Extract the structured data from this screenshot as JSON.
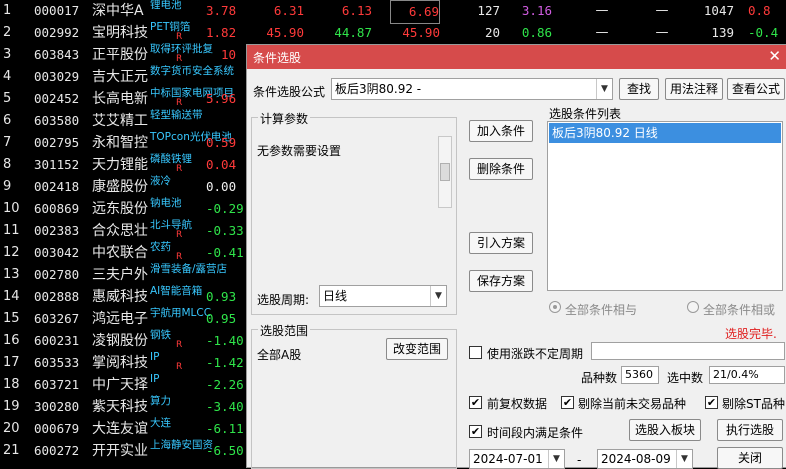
{
  "stocks": [
    {
      "idx": "1",
      "code": "000017",
      "name": "深中华A",
      "tag": "锂电池",
      "mark": "",
      "val": "3.78",
      "val_color": "red",
      "x1": "6.31",
      "x2": "6.13",
      "x3": "6.69",
      "x4": "127",
      "x5": "3.16",
      "x6": "—",
      "x7": "—",
      "x8": "1047",
      "x9": "0.8"
    },
    {
      "idx": "2",
      "code": "002992",
      "name": "宝明科技",
      "tag": "PET铜箔",
      "mark": "R",
      "val": "1.82",
      "val_color": "red",
      "x1": "45.90",
      "x2": "44.87",
      "x3": "45.90",
      "x4": "20",
      "x5": "0.86",
      "x6": "—",
      "x7": "—",
      "x8": "139",
      "x9": "-0.4"
    },
    {
      "idx": "3",
      "code": "603843",
      "name": "正平股份",
      "tag": "取得环评批复",
      "mark": "R",
      "val": "10",
      "val_color": "red"
    },
    {
      "idx": "4",
      "code": "003029",
      "name": "吉大正元",
      "tag": "数字货币安全系统",
      "mark": "",
      "val": "",
      "val_color": "red"
    },
    {
      "idx": "5",
      "code": "002452",
      "name": "长高电新",
      "tag": "中标国家电网项目",
      "mark": "R",
      "val": "5.96",
      "val_color": "red"
    },
    {
      "idx": "6",
      "code": "603580",
      "name": "艾艾精工",
      "tag": "轻型输送带",
      "mark": "",
      "val": "",
      "val_color": "red"
    },
    {
      "idx": "7",
      "code": "002795",
      "name": "永和智控",
      "tag": "TOPcon光伏电池",
      "mark": "",
      "val": "0.59",
      "val_color": "red"
    },
    {
      "idx": "8",
      "code": "301152",
      "name": "天力锂能",
      "tag": "磷酸铁锂",
      "mark": "R",
      "val": "0.04",
      "val_color": "red"
    },
    {
      "idx": "9",
      "code": "002418",
      "name": "康盛股份",
      "tag": "液冷",
      "mark": "",
      "val": "0.00",
      "val_color": "white"
    },
    {
      "idx": "10",
      "code": "600869",
      "name": "远东股份",
      "tag": "钠电池",
      "mark": "",
      "val": "-0.29",
      "val_color": "green"
    },
    {
      "idx": "11",
      "code": "002383",
      "name": "合众思壮",
      "tag": "北斗导航",
      "mark": "R",
      "val": "-0.33",
      "val_color": "green"
    },
    {
      "idx": "12",
      "code": "003042",
      "name": "中农联合",
      "tag": "农药",
      "mark": "R",
      "val": "-0.41",
      "val_color": "green"
    },
    {
      "idx": "13",
      "code": "002780",
      "name": "三夫户外",
      "tag": "滑雪装备/露营店",
      "mark": "",
      "val": "",
      "val_color": "green"
    },
    {
      "idx": "14",
      "code": "002888",
      "name": "惠威科技",
      "tag": "AI智能音箱",
      "mark": "",
      "val": "0.93",
      "val_color": "green"
    },
    {
      "idx": "15",
      "code": "603267",
      "name": "鸿远电子",
      "tag": "宇航用MLCC",
      "mark": "",
      "val": "0.95",
      "val_color": "green"
    },
    {
      "idx": "16",
      "code": "600231",
      "name": "凌钢股份",
      "tag": "钢铁",
      "mark": "R",
      "val": "-1.40",
      "val_color": "green"
    },
    {
      "idx": "17",
      "code": "603533",
      "name": "掌阅科技",
      "tag": "IP",
      "mark": "R",
      "val": "-1.42",
      "val_color": "green"
    },
    {
      "idx": "18",
      "code": "603721",
      "name": "中广天择",
      "tag": "IP",
      "mark": "",
      "val": "-2.26",
      "val_color": "green"
    },
    {
      "idx": "19",
      "code": "300280",
      "name": "紫天科技",
      "tag": "算力",
      "mark": "",
      "val": "-3.40",
      "val_color": "green"
    },
    {
      "idx": "20",
      "code": "000679",
      "name": "大连友谊",
      "tag": "大连",
      "mark": "",
      "val": "-6.11",
      "val_color": "green"
    },
    {
      "idx": "21",
      "code": "600272",
      "name": "开开实业",
      "tag": "上海静安国资",
      "mark": "",
      "val": "-6.50",
      "val_color": "green"
    }
  ],
  "dialog": {
    "title": "条件选股",
    "close_glyph": "✕",
    "formula_label": "条件选股公式",
    "formula_value": "板后3阴80.92  -",
    "find_btn": "查找",
    "usage_btn": "用法注释",
    "view_btn": "查看公式",
    "calc_params_label": "计算参数",
    "no_params_text": "无参数需要设置",
    "add_btn": "加入条件",
    "del_btn": "删除条件",
    "import_btn": "引入方案",
    "save_btn": "保存方案",
    "list_label": "选股条件列表",
    "list_items": [
      "板后3阴80.92  日线"
    ],
    "period_label": "选股周期:",
    "period_value": "日线",
    "radio_and": "全部条件相与",
    "radio_or": "全部条件相或",
    "done_status": "选股完毕.",
    "range_label": "选股范围",
    "range_value": "全部A股",
    "change_range_btn": "改变范围",
    "uncertain_period": "使用涨跌不定周期",
    "total_label": "品种数",
    "total_value": "5360",
    "selected_label": "选中数",
    "selected_value": "21/0.4%",
    "prerestore": "前复权数据",
    "exclude_untraded": "剔除当前未交易品种",
    "exclude_st": "剔除ST品种",
    "time_cond": "时间段内满足条件",
    "to_block_btn": "选股入板块",
    "run_btn": "执行选股",
    "date_from": "2024-07-01",
    "date_sep": "-",
    "date_to": "2024-08-09",
    "close_btn": "关闭",
    "accent_color": "#d64b4b"
  }
}
